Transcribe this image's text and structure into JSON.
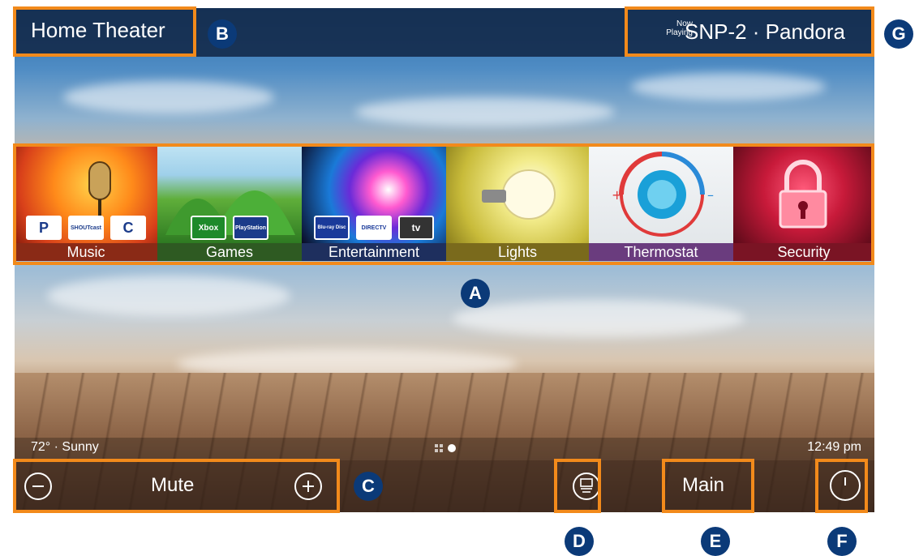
{
  "header": {
    "room_title": "Home Theater",
    "now_playing_label_line1": "Now",
    "now_playing_label_line2": "Playing",
    "now_playing_source": "SNP-2 · Pandora"
  },
  "tiles": [
    {
      "label": "Music",
      "badges": [
        "P",
        "SHOUTcast",
        "C"
      ],
      "label_bg": "#8a2a16"
    },
    {
      "label": "Games",
      "badges": [
        "Xbox",
        "PlayStation"
      ],
      "label_bg": "#2e5a22"
    },
    {
      "label": "Entertainment",
      "badges": [
        "Blu-ray Disc",
        "DIRECTV",
        "tv"
      ],
      "label_bg": "#1e2f5e"
    },
    {
      "label": "Lights",
      "badges": [],
      "label_bg": "#7a6a1c"
    },
    {
      "label": "Thermostat",
      "badges": [],
      "label_bg": "#6a3c7e"
    },
    {
      "label": "Security",
      "badges": [],
      "label_bg": "#7a1424"
    }
  ],
  "status": {
    "weather": "72° · Sunny",
    "time": "12:49 pm"
  },
  "controls": {
    "mute_label": "Mute",
    "zone_label": "Main",
    "volume_down_icon": "minus-circle-icon",
    "volume_up_icon": "plus-circle-icon",
    "remote_icon": "remote-control-icon",
    "power_icon": "power-icon"
  },
  "callouts": {
    "A": "A",
    "B": "B",
    "C": "C",
    "D": "D",
    "E": "E",
    "F": "F",
    "G": "G"
  },
  "colors": {
    "callout_border": "#f28a1b",
    "marker_bg": "#0b3a78",
    "top_bar": "#122848"
  }
}
